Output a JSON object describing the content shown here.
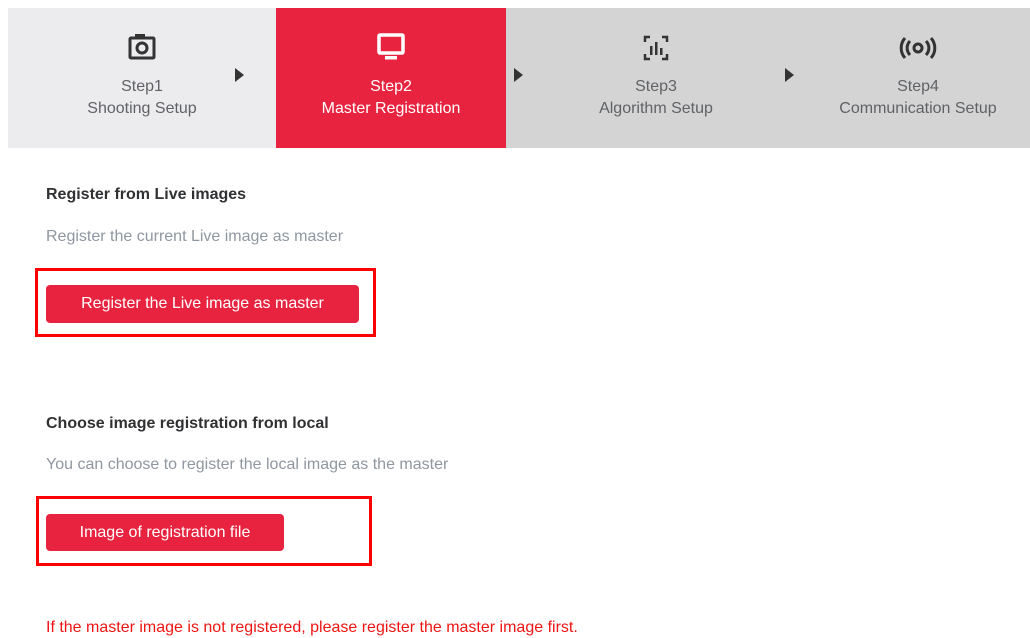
{
  "steps": [
    {
      "line1": "Step1",
      "line2": "Shooting Setup",
      "icon": "camera-icon",
      "active": false
    },
    {
      "line1": "Step2",
      "line2": "Master Registration",
      "icon": "monitor-icon",
      "active": true
    },
    {
      "line1": "Step3",
      "line2": "Algorithm Setup",
      "icon": "chart-scan-icon",
      "active": false
    },
    {
      "line1": "Step4",
      "line2": "Communication Setup",
      "icon": "signal-broadcast-icon",
      "active": false
    }
  ],
  "colors": {
    "accent": "#e8233f",
    "highlight": "#ff0000",
    "warning": "#ee1515"
  },
  "live": {
    "title": "Register from Live images",
    "desc": "Register the current Live image as master",
    "button": "Register the Live image as master"
  },
  "local": {
    "title": "Choose image registration from local",
    "desc": "You can choose to register the local image as the master",
    "button": "Image of registration file"
  },
  "warning": "If the master image is not registered, please register the master image first."
}
